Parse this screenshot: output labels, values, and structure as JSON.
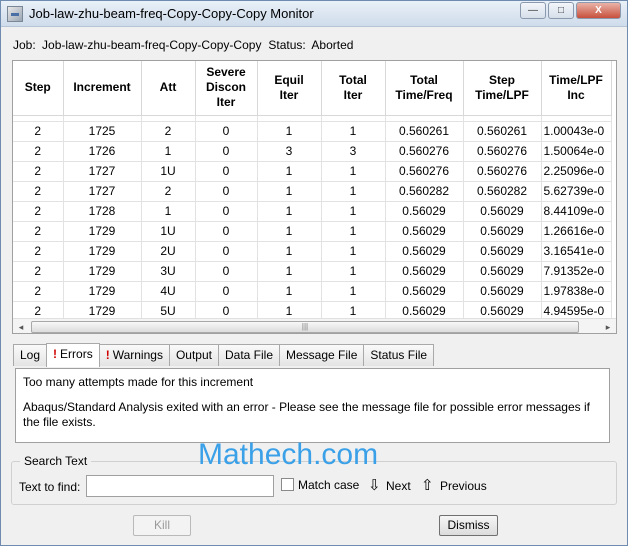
{
  "window": {
    "title": "Job-law-zhu-beam-freq-Copy-Copy-Copy Monitor",
    "min_glyph": "—",
    "max_glyph": "□",
    "close_glyph": "X"
  },
  "job": {
    "job_label": "Job:",
    "job_name": "Job-law-zhu-beam-freq-Copy-Copy-Copy",
    "status_label": "Status:",
    "status_value": "Aborted"
  },
  "table": {
    "columns": [
      {
        "line1": "Step",
        "line2": ""
      },
      {
        "line1": "Increment",
        "line2": ""
      },
      {
        "line1": "Att",
        "line2": ""
      },
      {
        "line1": "Severe",
        "line2": "Discon",
        "line3": "Iter"
      },
      {
        "line1": "Equil",
        "line2": "Iter"
      },
      {
        "line1": "Total",
        "line2": "Iter"
      },
      {
        "line1": "Total",
        "line2": "Time/Freq"
      },
      {
        "line1": "Step",
        "line2": "Time/LPF"
      },
      {
        "line1": "Time/LPF",
        "line2": "Inc"
      }
    ],
    "rows": [
      [
        "2",
        "1725",
        "2",
        "0",
        "1",
        "1",
        "0.560261",
        "0.560261",
        "1.00043e-0"
      ],
      [
        "2",
        "1726",
        "1",
        "0",
        "3",
        "3",
        "0.560276",
        "0.560276",
        "1.50064e-0"
      ],
      [
        "2",
        "1727",
        "1U",
        "0",
        "1",
        "1",
        "0.560276",
        "0.560276",
        "2.25096e-0"
      ],
      [
        "2",
        "1727",
        "2",
        "0",
        "1",
        "1",
        "0.560282",
        "0.560282",
        "5.62739e-0"
      ],
      [
        "2",
        "1728",
        "1",
        "0",
        "1",
        "1",
        "0.56029",
        "0.56029",
        "8.44109e-0"
      ],
      [
        "2",
        "1729",
        "1U",
        "0",
        "1",
        "1",
        "0.56029",
        "0.56029",
        "1.26616e-0"
      ],
      [
        "2",
        "1729",
        "2U",
        "0",
        "1",
        "1",
        "0.56029",
        "0.56029",
        "3.16541e-0"
      ],
      [
        "2",
        "1729",
        "3U",
        "0",
        "1",
        "1",
        "0.56029",
        "0.56029",
        "7.91352e-0"
      ],
      [
        "2",
        "1729",
        "4U",
        "0",
        "1",
        "1",
        "0.56029",
        "0.56029",
        "1.97838e-0"
      ],
      [
        "2",
        "1729",
        "5U",
        "0",
        "1",
        "1",
        "0.56029",
        "0.56029",
        "4.94595e-0"
      ]
    ],
    "scroll_left": "◂",
    "scroll_right": "▸",
    "scroll_grip": "|||"
  },
  "tabs": [
    {
      "label": "Log",
      "warn": ""
    },
    {
      "label": "Errors",
      "warn": "!"
    },
    {
      "label": "Warnings",
      "warn": "!"
    },
    {
      "label": "Output",
      "warn": ""
    },
    {
      "label": "Data File",
      "warn": ""
    },
    {
      "label": "Message File",
      "warn": ""
    },
    {
      "label": "Status File",
      "warn": ""
    }
  ],
  "active_tab": "Errors",
  "messages": {
    "line1": "Too many attempts made for this increment",
    "line2": "Abaqus/Standard Analysis exited with an error - Please see the  message file for possible error messages if",
    "line3": "the file exists."
  },
  "search": {
    "group_title": "Search Text",
    "find_label": "Text to find:",
    "find_value": "",
    "match_case": "Match case",
    "next": "Next",
    "previous": "Previous",
    "next_glyph": "⇩",
    "prev_glyph": "⇧"
  },
  "buttons": {
    "kill": "Kill",
    "dismiss": "Dismiss"
  },
  "watermark": "Mathech.com"
}
